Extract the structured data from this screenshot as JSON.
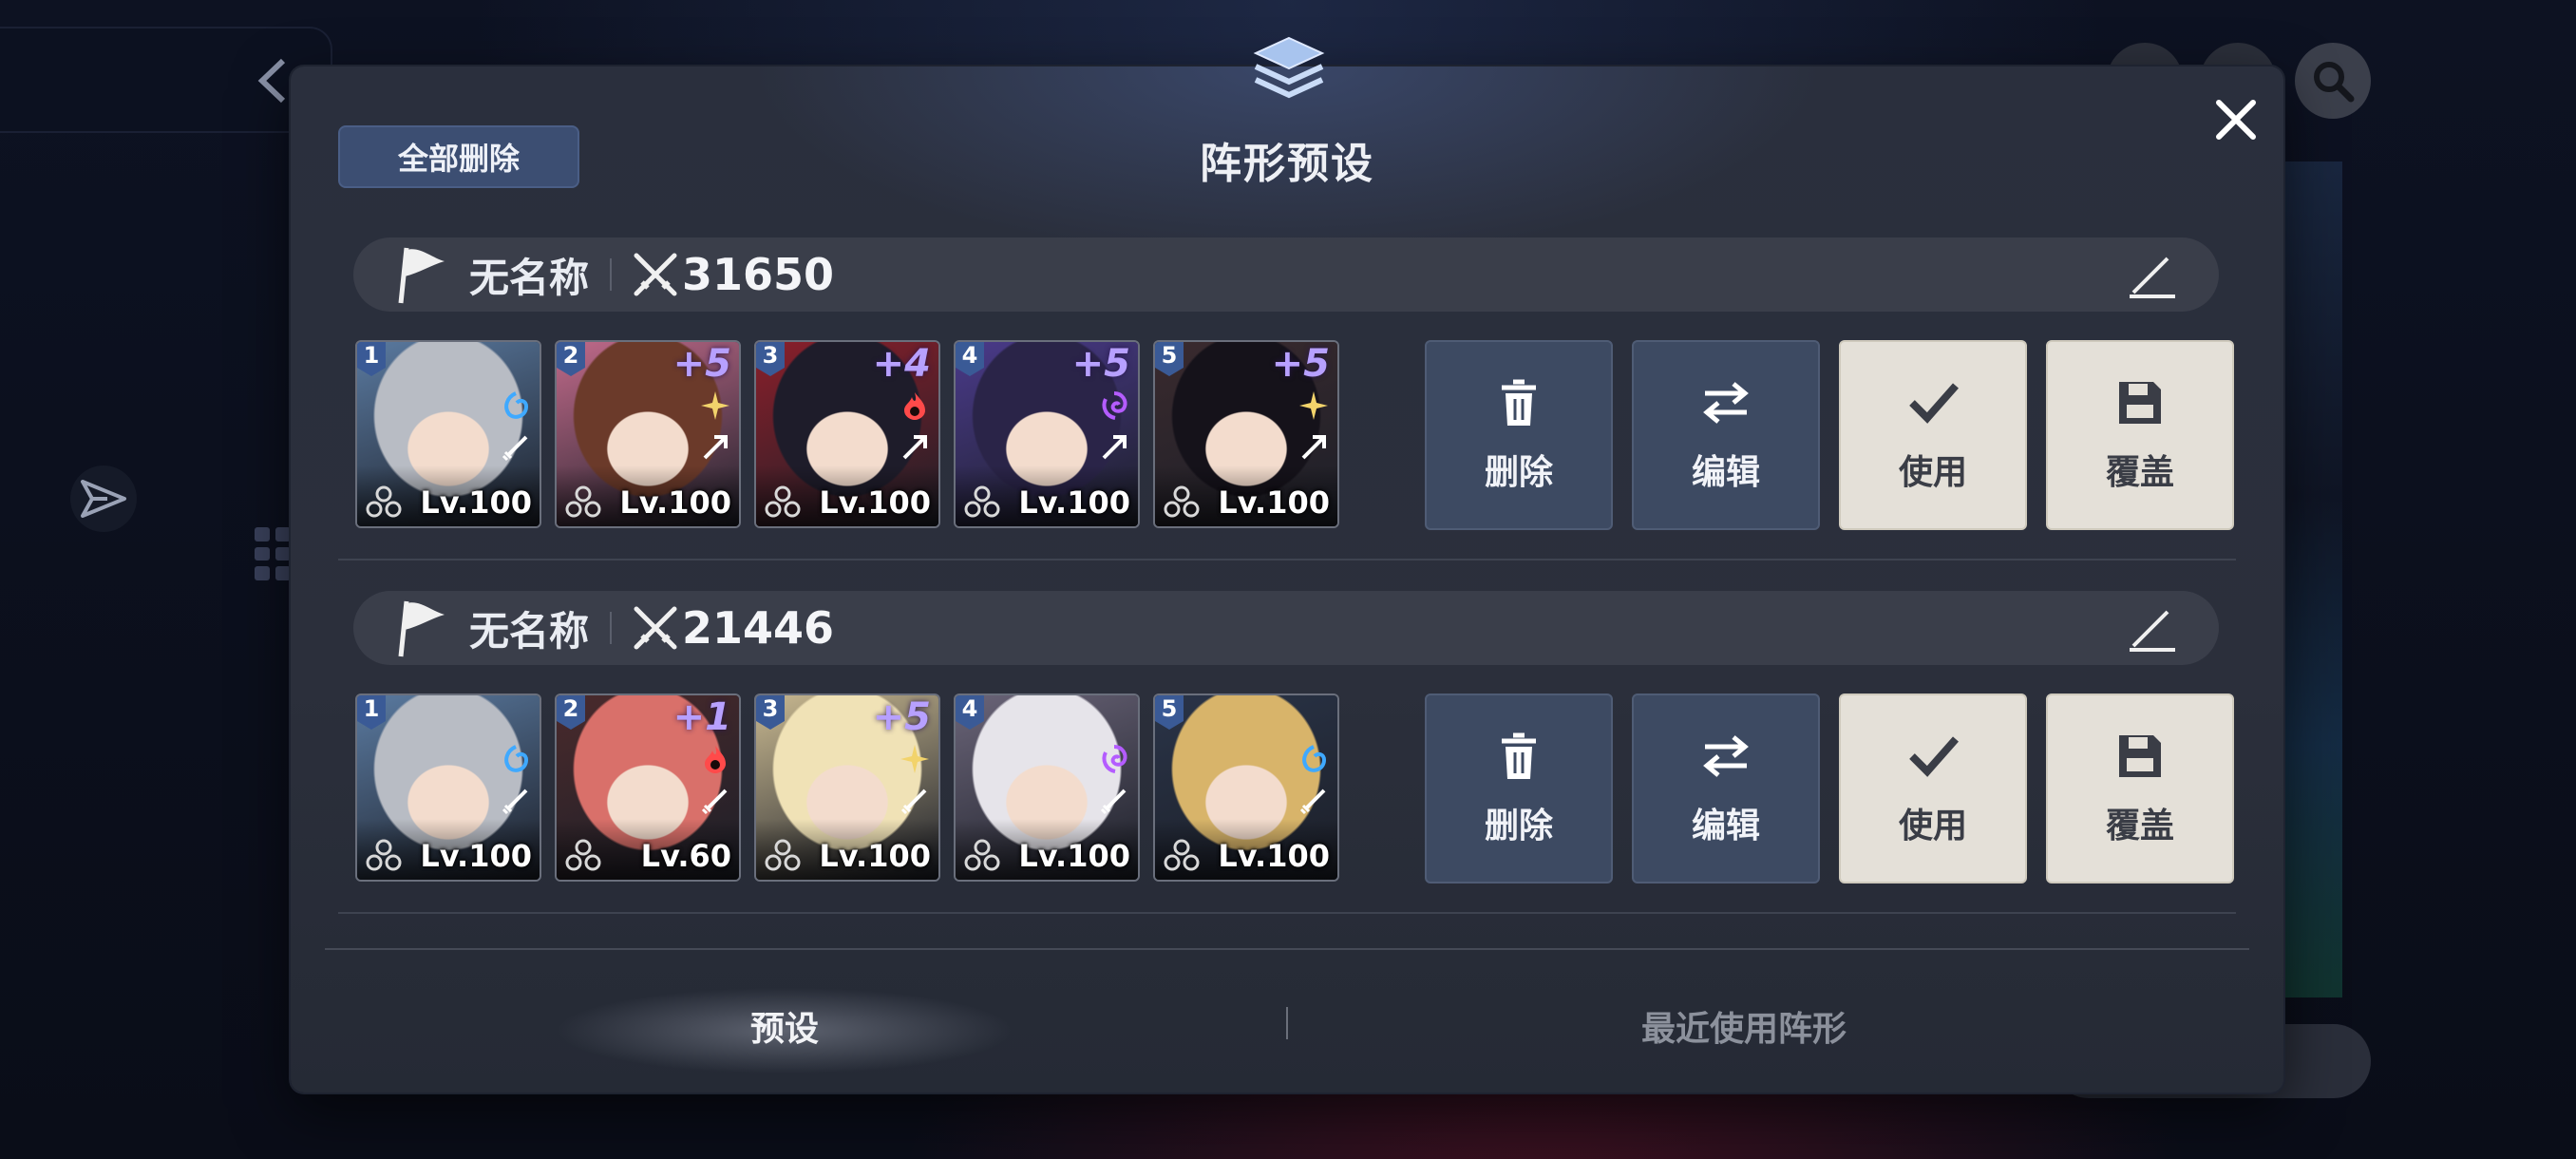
{
  "modal": {
    "title": "阵形预设",
    "delete_all_label": "全部删除"
  },
  "teams": [
    {
      "name": "无名称",
      "power": "31650",
      "members": [
        {
          "slot": "1",
          "plus": "",
          "level": "Lv.100",
          "element": "water",
          "element_color": "#3fa9ff",
          "role": "sword",
          "hair": "#b8bcc4",
          "bg": "#5a7aa0"
        },
        {
          "slot": "2",
          "plus": "+5",
          "level": "Lv.100",
          "element": "light",
          "element_color": "#f2d36b",
          "role": "arrow",
          "hair": "#6b3a2a",
          "bg": "#c06a8a"
        },
        {
          "slot": "3",
          "plus": "+4",
          "level": "Lv.100",
          "element": "fire",
          "element_color": "#ff4a4a",
          "role": "arrow",
          "hair": "#1e1c2a",
          "bg": "#8a1f2a"
        },
        {
          "slot": "4",
          "plus": "+5",
          "level": "Lv.100",
          "element": "dark",
          "element_color": "#b45cff",
          "role": "arrow",
          "hair": "#2a2448",
          "bg": "#4a3a8a"
        },
        {
          "slot": "5",
          "plus": "+5",
          "level": "Lv.100",
          "element": "light",
          "element_color": "#f2d36b",
          "role": "arrow",
          "hair": "#15121a",
          "bg": "#3a2a2e"
        }
      ]
    },
    {
      "name": "无名称",
      "power": "21446",
      "members": [
        {
          "slot": "1",
          "plus": "",
          "level": "Lv.100",
          "element": "water",
          "element_color": "#3fa9ff",
          "role": "sword",
          "hair": "#b8bcc4",
          "bg": "#5a7aa0"
        },
        {
          "slot": "2",
          "plus": "+1",
          "level": "Lv.60",
          "element": "fire",
          "element_color": "#ff4a4a",
          "role": "sword",
          "hair": "#d9706a",
          "bg": "#4a2a2c"
        },
        {
          "slot": "3",
          "plus": "+5",
          "level": "Lv.100",
          "element": "light",
          "element_color": "#f2d36b",
          "role": "sword",
          "hair": "#f0e2b6",
          "bg": "#c8b890"
        },
        {
          "slot": "4",
          "plus": "",
          "level": "Lv.100",
          "element": "dark",
          "element_color": "#b45cff",
          "role": "sword",
          "hair": "#e6e4ea",
          "bg": "#6a6478"
        },
        {
          "slot": "5",
          "plus": "",
          "level": "Lv.100",
          "element": "water",
          "element_color": "#3fa9ff",
          "role": "sword",
          "hair": "#d8b46a",
          "bg": "#2a3448"
        }
      ]
    }
  ],
  "actions": {
    "delete": "删除",
    "edit": "编辑",
    "use": "使用",
    "overwrite": "覆盖"
  },
  "tabs": {
    "preset": "预设",
    "recent": "最近使用阵形"
  },
  "colors": {
    "accent_button": "#3c4e72",
    "dark_action": "#3d4a62",
    "light_action": "#e4e0d8"
  }
}
